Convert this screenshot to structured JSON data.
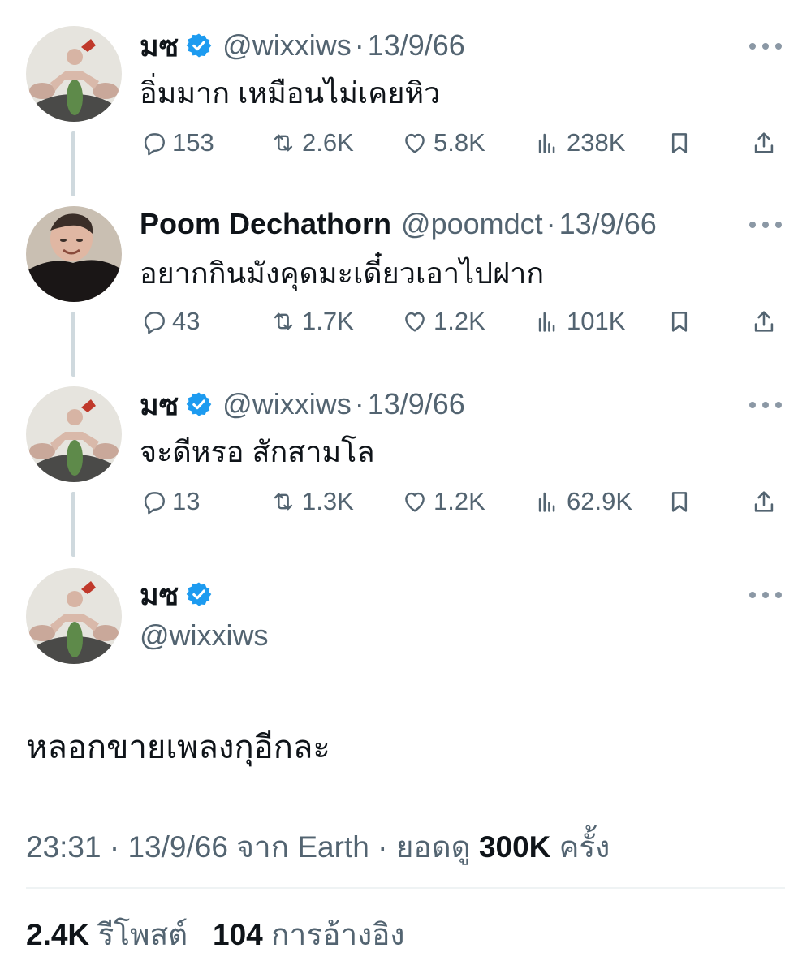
{
  "thread": [
    {
      "name": "มซ",
      "verified": true,
      "handle": "@wixxiws",
      "separator": "·",
      "date": "13/9/66",
      "text": "อิ่มมาก เหมือนไม่เคยหิว",
      "replies": "153",
      "reposts": "2.6K",
      "likes": "5.8K",
      "views": "238K"
    },
    {
      "name": "Poom Dechathorn",
      "verified": false,
      "handle": "@poomdct",
      "separator": "·",
      "date": "13/9/66",
      "text": "อยากกินมังคุดมะเดี๋ยวเอาไปฝาก",
      "replies": "43",
      "reposts": "1.7K",
      "likes": "1.2K",
      "views": "101K"
    },
    {
      "name": "มซ",
      "verified": true,
      "handle": "@wixxiws",
      "separator": "·",
      "date": "13/9/66",
      "text": "จะดีหรอ สักสามโล",
      "replies": "13",
      "reposts": "1.3K",
      "likes": "1.2K",
      "views": "62.9K"
    }
  ],
  "main_tweet": {
    "name": "มซ",
    "handle": "@wixxiws",
    "text": "หลอกขายเพลงกุอีกละ",
    "time": "23:31",
    "separator": "·",
    "date": "13/9/66",
    "source_prefix": "จาก",
    "source": "Earth",
    "views_prefix": "ยอดดู",
    "views": "300K",
    "views_suffix": "ครั้ง",
    "reposts_count": "2.4K",
    "reposts_label": "รีโพสต์",
    "quotes_count": "104",
    "quotes_label": "การอ้างอิง"
  },
  "icons": {
    "reply": "reply-icon",
    "repost": "repost-icon",
    "like": "heart-icon",
    "views": "analytics-icon",
    "bookmark": "bookmark-icon",
    "share": "share-icon",
    "verified": "verified-badge-icon",
    "more": "more-icon"
  },
  "colors": {
    "verified": "#1d9bf0",
    "secondary_text": "#536471",
    "thread_line": "#cfd9de"
  }
}
